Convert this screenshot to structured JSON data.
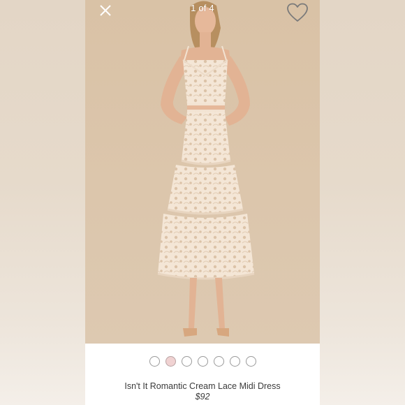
{
  "viewer": {
    "counter_text": "1 of 4",
    "close_icon": "close-icon",
    "favorite_icon": "heart-outline-icon",
    "active_image_index": 1,
    "dot_count": 7
  },
  "product": {
    "name": "Isn't It Romantic Cream Lace Midi Dress",
    "price": "$92"
  },
  "colors": {
    "background_beige": "#d9c2a6",
    "dress_cream": "#f3e4d4",
    "active_dot": "#f0d2d2"
  }
}
